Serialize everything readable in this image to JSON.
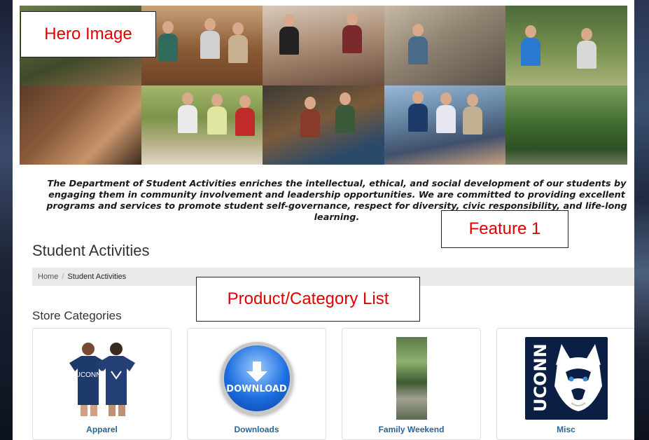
{
  "overlays": {
    "hero": "Hero Image",
    "feature": "Feature 1",
    "list": "Product/Category List"
  },
  "mission": "The Department of Student Activities enriches the intellectual, ethical, and social development of our students by engaging them in community involvement and leadership opportunities.  We are committed to providing excellent programs and services to promote student self-governance, respect for diversity, civic responsibility, and life-long learning.",
  "page_title": "Student Activities",
  "breadcrumb": {
    "home": "Home",
    "separator": "/",
    "current": "Student Activities"
  },
  "section_title": "Store Categories",
  "categories": [
    {
      "name": "Apparel",
      "image": "uconn-shirts-photo"
    },
    {
      "name": "Downloads",
      "image": "download-icon",
      "image_text": "DOWNLOAD"
    },
    {
      "name": "Family Weekend",
      "image": "campus-photo-strip"
    },
    {
      "name": "Misc",
      "image": "uconn-husky-logo",
      "logo_text": "UCONN"
    }
  ],
  "colors": {
    "overlay_text": "#e00000",
    "link": "#2a6496",
    "logo_bg": "#0b1f44"
  }
}
